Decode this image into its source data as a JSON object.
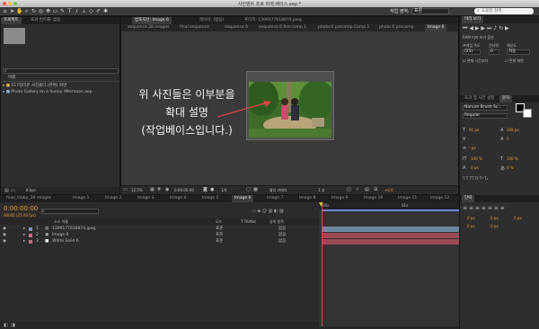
{
  "window": {
    "title": "사진맨트 프로 퍼펙 베이스.aep *"
  },
  "toolbar": {
    "workspace_label": "작업 영역:",
    "workspace_value": "표준",
    "search_placeholder": "도움말 검색"
  },
  "project_panel": {
    "tabs": [
      "프로젝트",
      "효과 컨트롤: 없음"
    ],
    "search_value": "",
    "column_header": "이름",
    "items": [
      {
        "name": "517정리본 사진폴더 (본편) 화면",
        "type": "folder"
      },
      {
        "name": "Photo Gallery on a Sunny Afternoon.aep",
        "type": "aep"
      }
    ],
    "footer_bpc": "8 bpc"
  },
  "comp_panel": {
    "tabs": [
      "컴포지션: Image 6",
      "레이어: (없음)",
      "푸티지: 1399177618874.jpeg"
    ],
    "breadcrumbs": [
      "sequence 28 images",
      "final sequence",
      "sequence 6",
      "sequence 6 fire-comp 1",
      "photo 6 precomp Comp 1",
      "photo 6 precomp",
      "Image 6"
    ],
    "annotation_lines": [
      "위 사진들은 이부분을",
      "확대 설명",
      "(작업베이스입니다.)"
    ],
    "viewer_zoom": "12.5%",
    "viewer_time": "0:00:00:00",
    "viewer_res": "1/4",
    "viewer_camera": "활성 카메라",
    "viewer_view": "1 뷰",
    "viewer_offset": "+0.0"
  },
  "timeline": {
    "tabs": [
      "final_lobby_28 images",
      "Image 1",
      "Image 2",
      "Image 3",
      "Image 4",
      "Image 5",
      "Image 6",
      "Image 7",
      "Image 8",
      "Image 9",
      "Image 10",
      "Image 11",
      "Image 12"
    ],
    "timecode": "0:00:00:00",
    "frame_info": "00000 (25.00 fps)",
    "col_source": "소스 이름",
    "col_mode": "모드",
    "col_trkmat": "T TrkMat",
    "col_parent": "상위 항목",
    "layers": [
      {
        "num": "1",
        "name": "1399177618874.jpeg",
        "mode": "표준",
        "parent": "없음",
        "color": "#7a9ab6"
      },
      {
        "num": "2",
        "name": "Image 6",
        "mode": "표준",
        "parent": "없음",
        "color": "#c96f7c"
      },
      {
        "num": "3",
        "name": "White Solid 6",
        "mode": "표준",
        "parent": "없음",
        "color": "#c96f7c"
      }
    ],
    "ruler_marks": [
      "00s",
      "01s"
    ]
  },
  "preview_panel": {
    "tab": "미리 보기",
    "ram_label": "RAM 미리 보기 옵션",
    "fps_label": "프레임 속도",
    "skip_label": "건너뛰",
    "res_label": "해상도",
    "fps_value": "(25)",
    "skip_value": "0",
    "res_value": "자동",
    "current_time_label": "현재 시간부터",
    "fullscreen_label": "전체 화면"
  },
  "character_panel": {
    "tabs": [
      "효과 및 사전 설정",
      "문자"
    ],
    "font": "Nanum Brush Sc...",
    "style": "Regular",
    "size": "91 px",
    "leading": "208 px",
    "tracking": "0",
    "px_a": "- px",
    "pct_a": "100 %",
    "pct_b": "100 %",
    "px_b": "0 px",
    "pct_c": "0 %"
  },
  "paragraph_panel": {
    "tab": "단락",
    "v1": "0 px",
    "v2": "0 px",
    "v3": "0 px",
    "v4": "0 px",
    "v5": "0 px"
  }
}
